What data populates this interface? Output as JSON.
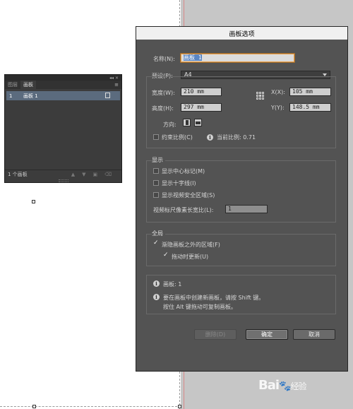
{
  "panel": {
    "tabs": [
      "图层",
      "画板"
    ],
    "top_controls": "◂◂ ×",
    "menu_icon": "≡",
    "rows": [
      {
        "num": "1",
        "name": "画板 1"
      }
    ],
    "footer": "1 个画板"
  },
  "dialog": {
    "title": "画板选项",
    "name_label": "名称(N):",
    "name_value": "画板 1",
    "preset_label": "预设(P):",
    "preset_value": "A4",
    "width_label": "宽度(W):",
    "width_value": "210 mm",
    "height_label": "高度(H):",
    "height_value": "297 mm",
    "x_label": "X(X):",
    "x_value": "105 mm",
    "y_label": "Y(Y):",
    "y_value": "148.5 mm",
    "orientation_label": "方向:",
    "constrain_label": "约束比例(C)",
    "current_ratio_label": "当前比例: 0.71",
    "display": {
      "title": "显示",
      "center_mark": "显示中心标记(M)",
      "cross_hairs": "显示十字线(I)",
      "video_safe": "显示视频安全区域(S)",
      "pixel_ratio_label": "视频标尺像素长宽比(L):",
      "pixel_ratio_value": "1"
    },
    "global": {
      "title": "全局",
      "fade_region": "渐隐画板之外的区域(F)",
      "update_drag": "拖动时更新(U)"
    },
    "info": {
      "artboards": "画板: 1",
      "hint_line1": "要在画板中创建新画板，请按 Shift 键。",
      "hint_line2": "按住 Alt 键拖动可复制画板。"
    },
    "buttons": {
      "delete": "删除(D)",
      "ok": "确定",
      "cancel": "取消"
    }
  },
  "watermark": {
    "brand": "Bai",
    "sub": "经验"
  },
  "colors": {
    "dialog_bg": "#535353",
    "panel_bg": "#3c3c3c",
    "focus_border": "#e8a04c",
    "selection_blue": "#5a86c4",
    "panel_row_selected": "#5b6b7e"
  }
}
